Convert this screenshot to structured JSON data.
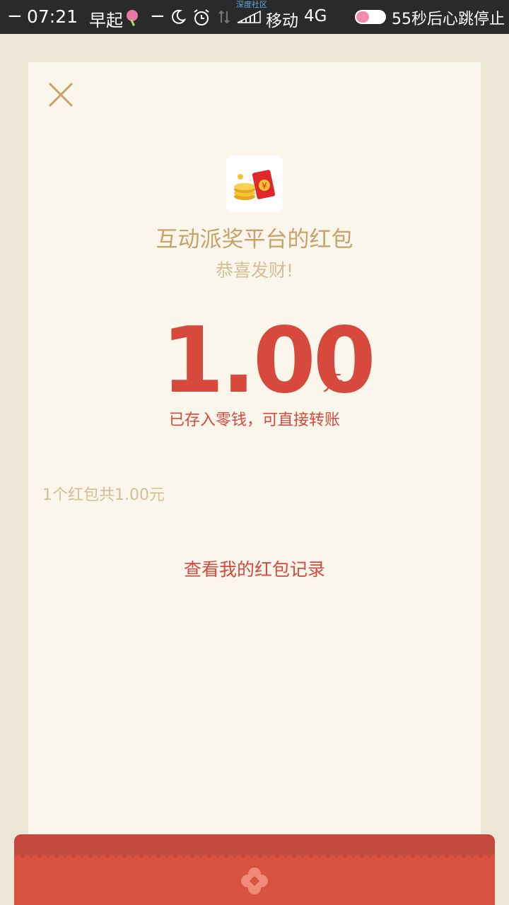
{
  "status_bar": {
    "dash_left": "−",
    "time": "07:21",
    "early": "早起",
    "dash_mid": "−",
    "watermark": "深度社区",
    "carrier": "移动",
    "network": "4G",
    "battery_level": 0.45,
    "heart_text": "55秒后心跳停止"
  },
  "envelope": {
    "title": "互动派奖平台的红包",
    "greeting": "恭喜发财!",
    "amount": "1.00",
    "unit": "元",
    "stored_note": "已存入零钱，可直接转账",
    "summary": "1个红包共1.00元",
    "records_link": "查看我的红包记录"
  },
  "colors": {
    "accent_red": "#d6493c",
    "gold": "#c8a26a",
    "paper": "#faf6eb",
    "background": "#ede5d5"
  },
  "icons": [
    "close-icon",
    "moon-icon",
    "alarm-icon",
    "signal-icon",
    "battery-icon",
    "red-envelope-app-icon",
    "envelope-emblem-icon"
  ]
}
